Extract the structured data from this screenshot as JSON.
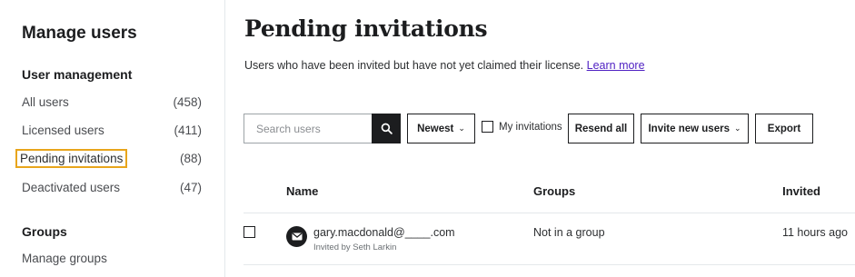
{
  "sidebar": {
    "title": "Manage users",
    "section_user_mgmt": "User management",
    "items": [
      {
        "label": "All users",
        "count": "(458)"
      },
      {
        "label": "Licensed users",
        "count": "(411)"
      },
      {
        "label": "Pending invitations",
        "count": "(88)"
      },
      {
        "label": "Deactivated users",
        "count": "(47)"
      }
    ],
    "section_groups": "Groups",
    "manage_groups": "Manage groups"
  },
  "main": {
    "title": "Pending invitations",
    "subtitle": "Users who have been invited but have not yet claimed their license.",
    "learn_more": "Learn more"
  },
  "toolbar": {
    "search_placeholder": "Search users",
    "sort_label": "Newest",
    "my_invitations_label": "My invitations",
    "resend_all_label": "Resend all",
    "invite_label": "Invite new users",
    "export_label": "Export"
  },
  "table": {
    "headers": {
      "name": "Name",
      "groups": "Groups",
      "invited": "Invited"
    },
    "rows": [
      {
        "email": "gary.macdonald@____.com",
        "invited_by": "Invited by Seth Larkin",
        "group": "Not in a group",
        "invited": "11 hours ago"
      }
    ]
  },
  "colors": {
    "active_outline": "#e8a51c",
    "link": "#5022c3",
    "dark": "#1c1d1f"
  },
  "icons": {
    "search": "search-icon",
    "chevron": "chevron-down-icon",
    "avatar": "envelope-icon"
  }
}
